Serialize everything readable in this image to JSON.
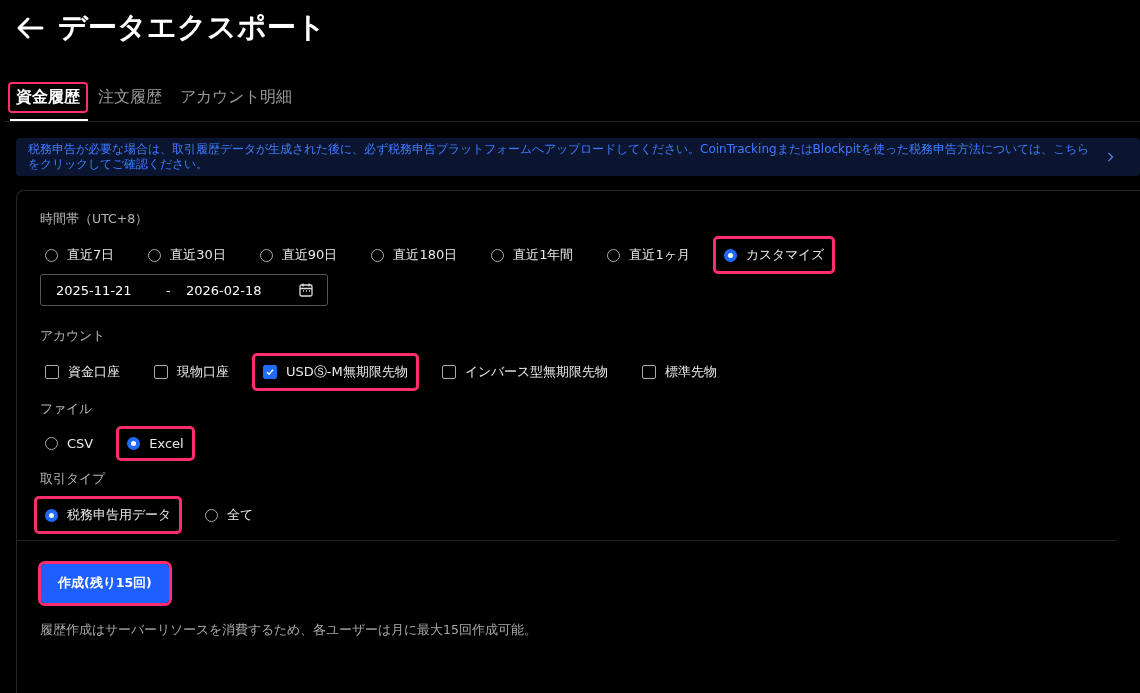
{
  "title": "データエクスポート",
  "tabs": [
    {
      "label": "資金履歴",
      "selected": true,
      "highlighted": true
    },
    {
      "label": "注文履歴",
      "selected": false,
      "highlighted": false
    },
    {
      "label": "アカウント明細",
      "selected": false,
      "highlighted": false
    }
  ],
  "banner": {
    "text": "税務申告が必要な場合は、取引履歴データが生成された後に、必ず税務申告プラットフォームへアップロードしてください。CoinTrackingまたはBlockpitを使った税務申告方法については、こちらをクリックしてご確認ください。"
  },
  "time_range": {
    "label": "時間帯（UTC+8）",
    "options": [
      {
        "label": "直近7日",
        "selected": false,
        "highlighted": false
      },
      {
        "label": "直近30日",
        "selected": false,
        "highlighted": false
      },
      {
        "label": "直近90日",
        "selected": false,
        "highlighted": false
      },
      {
        "label": "直近180日",
        "selected": false,
        "highlighted": false
      },
      {
        "label": "直近1年間",
        "selected": false,
        "highlighted": false
      },
      {
        "label": "直近1ヶ月",
        "selected": false,
        "highlighted": false
      },
      {
        "label": "カスタマイズ",
        "selected": true,
        "highlighted": true
      }
    ],
    "start_date": "2025-11-21",
    "separator": "-",
    "end_date": "2026-02-18"
  },
  "account": {
    "label": "アカウント",
    "options": [
      {
        "label": "資金口座",
        "checked": false,
        "highlighted": false
      },
      {
        "label": "現物口座",
        "checked": false,
        "highlighted": false
      },
      {
        "label": "USDⓈ-M無期限先物",
        "checked": true,
        "highlighted": true
      },
      {
        "label": "インバース型無期限先物",
        "checked": false,
        "highlighted": false
      },
      {
        "label": "標準先物",
        "checked": false,
        "highlighted": false
      }
    ]
  },
  "file": {
    "label": "ファイル",
    "options": [
      {
        "label": "CSV",
        "selected": false,
        "highlighted": false
      },
      {
        "label": "Excel",
        "selected": true,
        "highlighted": true
      }
    ]
  },
  "trade_type": {
    "label": "取引タイプ",
    "options": [
      {
        "label": "税務申告用データ",
        "selected": true,
        "highlighted": true
      },
      {
        "label": "全て",
        "selected": false,
        "highlighted": false
      }
    ]
  },
  "create_button": {
    "label": "作成(残り15回)",
    "highlighted": true
  },
  "note": "履歴作成はサーバーリソースを消費するため、各ユーザーは月に最大15回作成可能。"
}
